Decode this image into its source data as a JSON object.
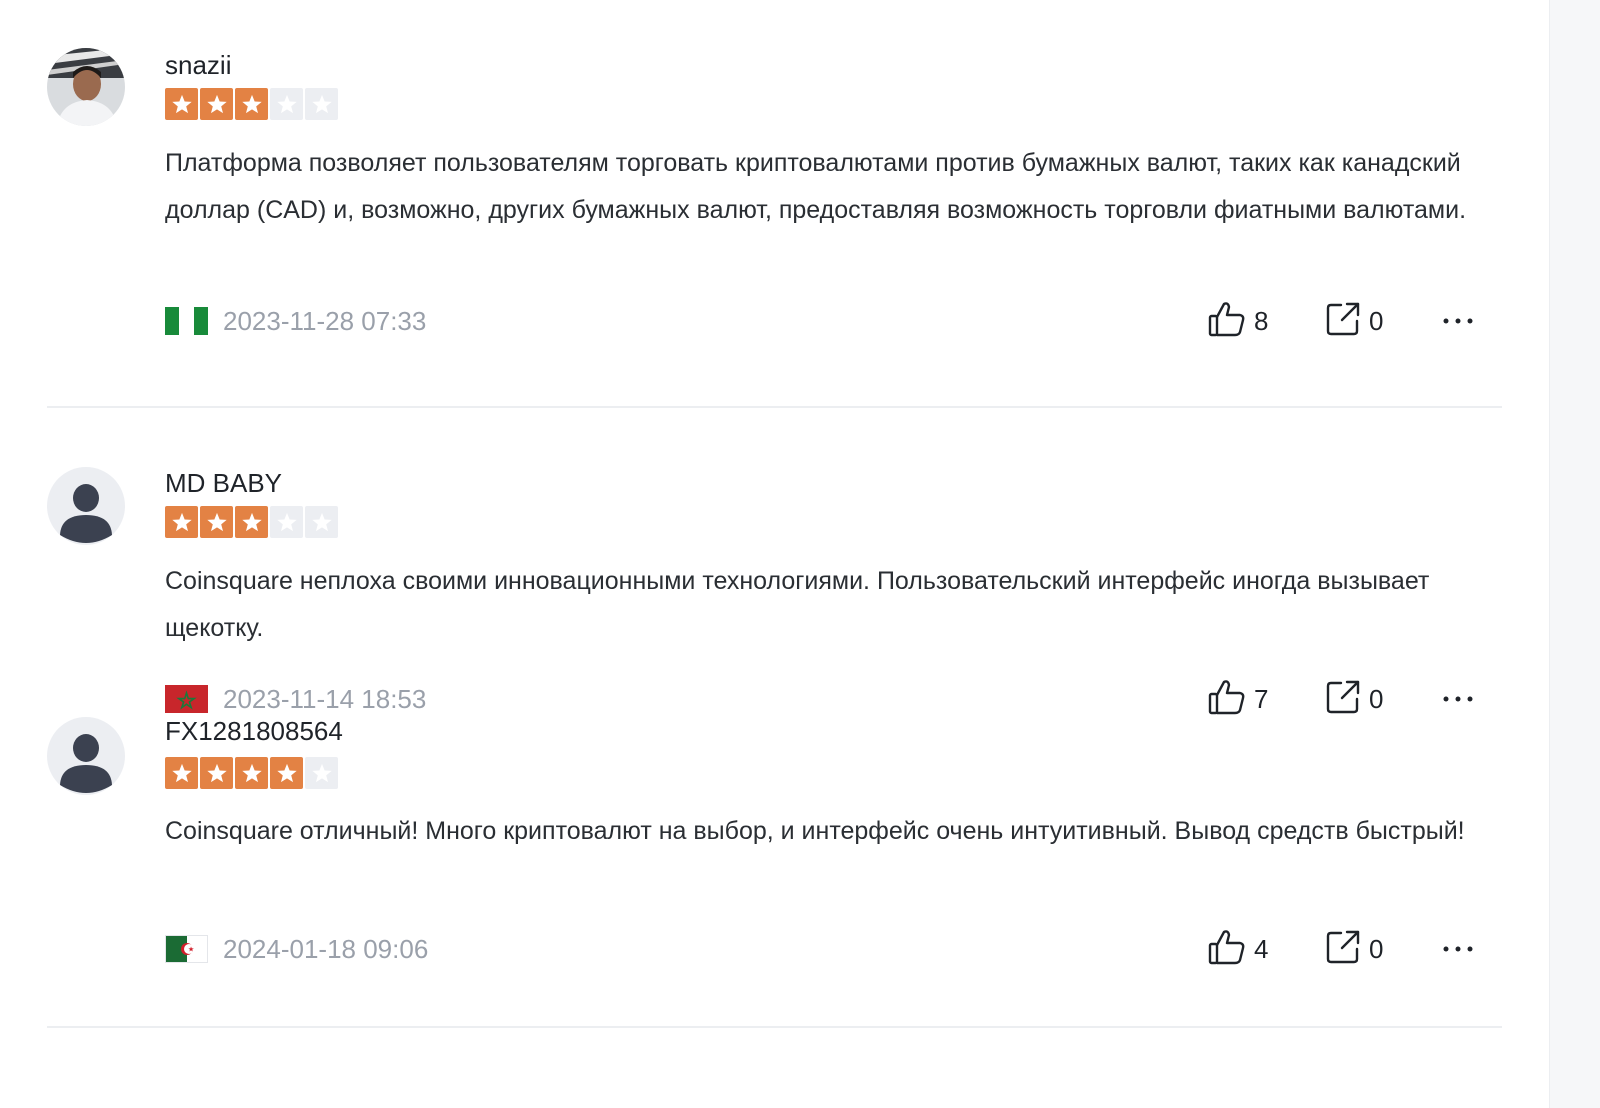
{
  "reviews": [
    {
      "username": "snazii",
      "rating": 3,
      "max_rating": 5,
      "text": "Платформа позволяет пользователям торговать криптовалютами против бумажных валют, таких как канадский доллар (CAD) и, возможно, других бумажных валют, предоставляя возможность торговли фиатными валютами.",
      "date": "2023-11-28 07:33",
      "likes": "8",
      "shares": "0",
      "flag": "nigeria-flag",
      "avatar": "user-photo-avatar"
    },
    {
      "username": "MD BABY",
      "rating": 3,
      "max_rating": 5,
      "text": "Coinsquare неплоха своими инновационными технологиями. Пользовательский интерфейс иногда вызывает щекотку.",
      "date": "2023-11-14 18:53",
      "likes": "7",
      "shares": "0",
      "flag": "morocco-flag",
      "avatar": "default-user-avatar"
    },
    {
      "username": "FX1281808564",
      "rating": 4,
      "max_rating": 5,
      "text": "Coinsquare отличный! Много криптовалют на выбор, и интерфейс очень интуитивный. Вывод средств быстрый!",
      "date": "2024-01-18 09:06",
      "likes": "4",
      "shares": "0",
      "flag": "algeria-flag",
      "avatar": "default-user-avatar"
    }
  ],
  "colors": {
    "star_on": "#e38244",
    "star_off": "#eceef2",
    "date": "#9aa0aa",
    "divider": "#eceef1"
  },
  "icons": {
    "like": "thumbs-up-icon",
    "share": "share-icon",
    "more": "more-icon",
    "star": "star-icon"
  }
}
